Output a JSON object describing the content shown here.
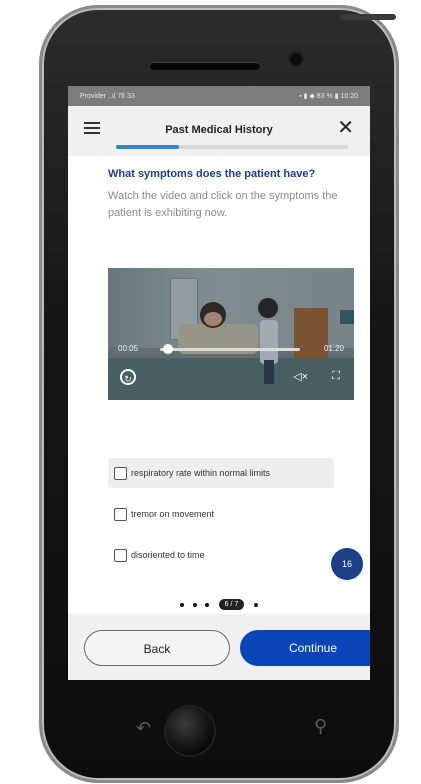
{
  "statusbar": {
    "left": "Provider ..ıl 76 33",
    "right": "▪ ▮ ◆ 83 % ▮ 10:20"
  },
  "header": {
    "title": "Past Medical History",
    "progress_fraction": 0.27
  },
  "question": {
    "title": "What symptoms does the patient have?",
    "instructions": "Watch the video and click on the symptoms the patient is exhibiting now."
  },
  "video": {
    "current_time": "00:05",
    "duration": "01:20",
    "seek_fraction": 0.05
  },
  "options": [
    {
      "label": "respiratory rate within normal limits"
    },
    {
      "label": "tremor on movement"
    },
    {
      "label": "disoriented to time"
    }
  ],
  "badge": {
    "text": "16"
  },
  "pager": {
    "current": "6 / 7"
  },
  "footer": {
    "back_label": "Back",
    "continue_label": "Continue"
  },
  "colors": {
    "accent": "#0a46b7",
    "question_title": "#1c3f8a",
    "progress": "#2a8cc8"
  }
}
